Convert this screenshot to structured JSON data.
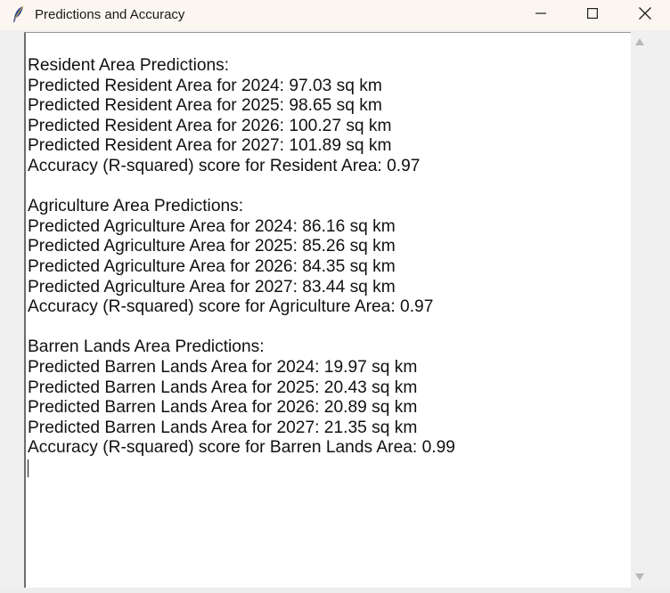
{
  "window": {
    "title": "Predictions and Accuracy",
    "icon": "feather-icon",
    "controls": [
      "minimize-icon",
      "maximize-icon",
      "close-icon"
    ]
  },
  "text_area": {
    "lines": [
      "Resident Area Predictions:",
      "Predicted Resident Area for 2024: 97.03 sq km",
      "Predicted Resident Area for 2025: 98.65 sq km",
      "Predicted Resident Area for 2026: 100.27 sq km",
      "Predicted Resident Area for 2027: 101.89 sq km",
      "Accuracy (R-squared) score for Resident Area: 0.97",
      "",
      "Agriculture Area Predictions:",
      "Predicted Agriculture Area for 2024: 86.16 sq km",
      "Predicted Agriculture Area for 2025: 85.26 sq km",
      "Predicted Agriculture Area for 2026: 84.35 sq km",
      "Predicted Agriculture Area for 2027: 83.44 sq km",
      "Accuracy (R-squared) score for Agriculture Area: 0.97",
      "",
      "Barren Lands Area Predictions:",
      "Predicted Barren Lands Area for 2024: 19.97 sq km",
      "Predicted Barren Lands Area for 2025: 20.43 sq km",
      "Predicted Barren Lands Area for 2026: 20.89 sq km",
      "Predicted Barren Lands Area for 2027: 21.35 sq km",
      "Accuracy (R-squared) score for Barren Lands Area: 0.99"
    ]
  },
  "scrollbar": {
    "up_icon": "scroll-up-arrow-icon",
    "down_icon": "scroll-down-arrow-icon"
  }
}
